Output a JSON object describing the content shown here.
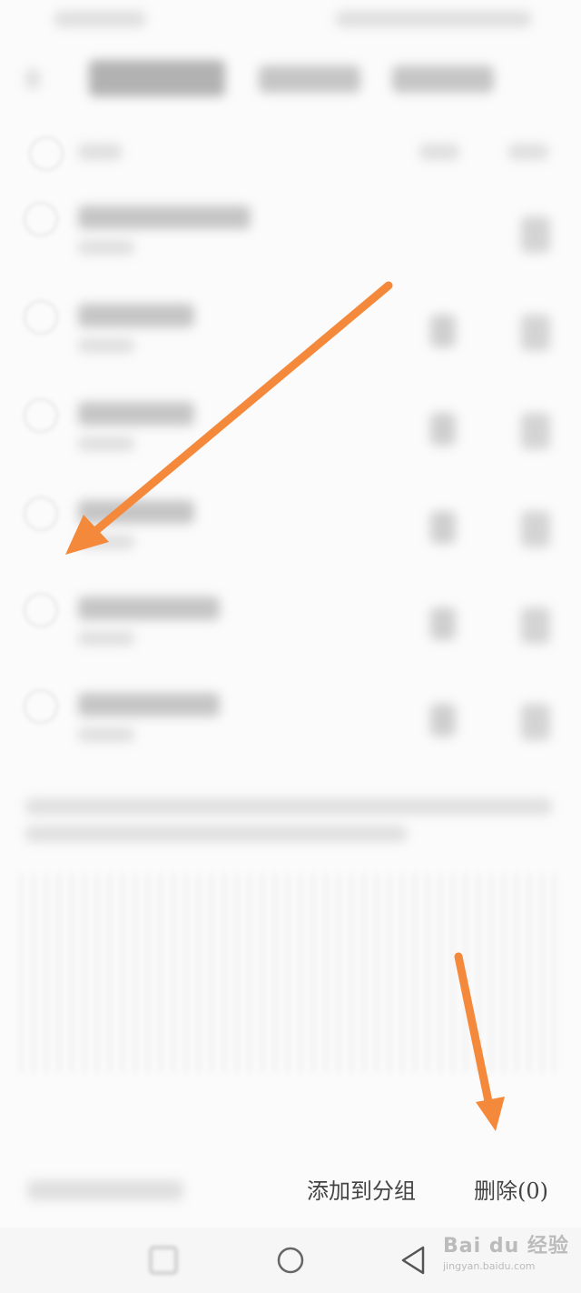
{
  "footer": {
    "add_to_group_label": "添加到分组",
    "delete_label": "删除(0)"
  },
  "watermark": {
    "logo_text": "Bai du 经验",
    "url": "jingyan.baidu.com"
  },
  "annotations": {
    "arrow_color": "#f4893b"
  },
  "nav": {
    "icons": [
      "recent-apps-icon",
      "home-icon",
      "back-icon"
    ]
  }
}
